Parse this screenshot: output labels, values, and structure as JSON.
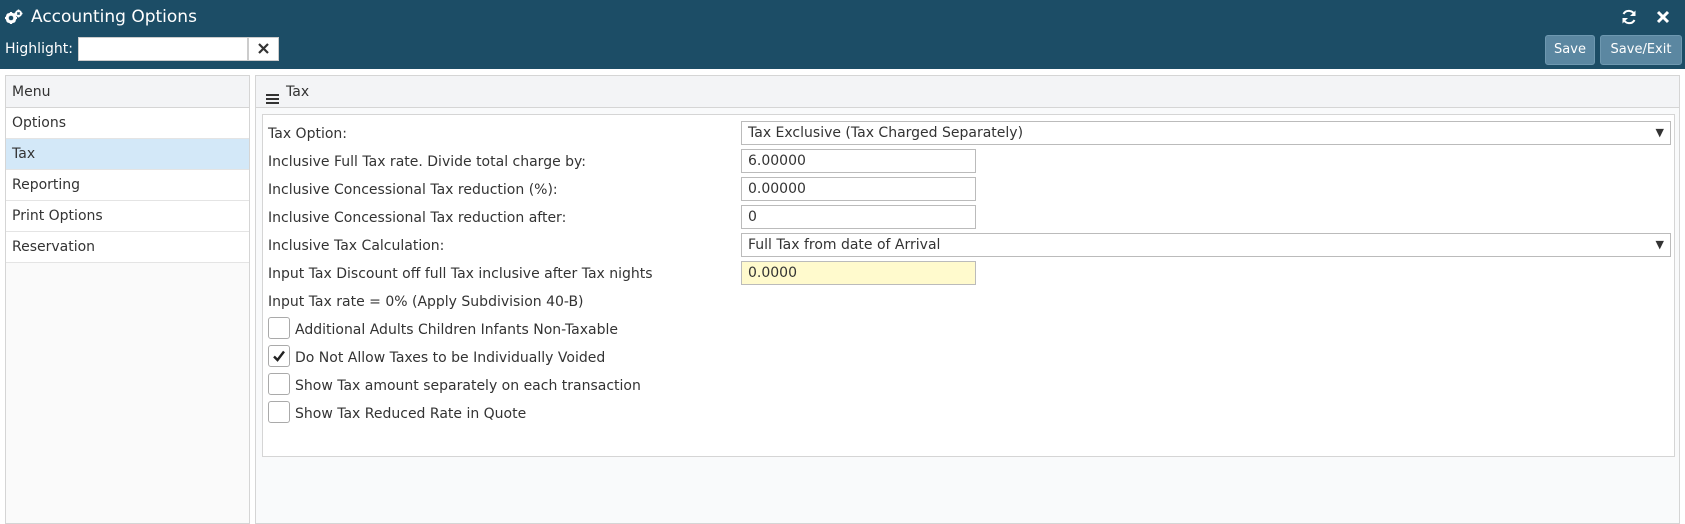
{
  "header": {
    "title": "Accounting Options",
    "app_icon": "cogs-icon",
    "highlight_label": "Highlight:",
    "highlight_value": "",
    "save_label": "Save",
    "save_exit_label": "Save/Exit",
    "accent_color": "#1c4d66"
  },
  "sidebar": {
    "heading": "Menu",
    "items": [
      {
        "label": "Options",
        "active": false
      },
      {
        "label": "Tax",
        "active": true
      },
      {
        "label": "Reporting",
        "active": false
      },
      {
        "label": "Print Options",
        "active": false
      },
      {
        "label": "Reservation",
        "active": false
      }
    ]
  },
  "main": {
    "heading": "Tax",
    "fields": {
      "tax_option": {
        "label": "Tax Option:",
        "value": "Tax Exclusive (Tax Charged Separately)"
      },
      "full_rate": {
        "label": "Inclusive Full Tax rate. Divide total charge by:",
        "value": "6.00000"
      },
      "concessional_reduction": {
        "label": "Inclusive Concessional Tax reduction (%):",
        "value": "0.00000"
      },
      "concessional_after": {
        "label": "Inclusive Concessional Tax reduction after:",
        "value": "0"
      },
      "tax_calculation": {
        "label": "Inclusive Tax Calculation:",
        "value": "Full Tax from date of Arrival"
      },
      "input_discount": {
        "label": "Input Tax Discount off full Tax inclusive after Tax nights",
        "value": "0.0000"
      }
    },
    "input_tax_note": "Input Tax rate = 0% (Apply Subdivision 40-B)",
    "checkboxes": [
      {
        "label": "Additional Adults Children Infants Non-Taxable",
        "checked": false
      },
      {
        "label": "Do Not Allow Taxes to be Individually Voided",
        "checked": true
      },
      {
        "label": "Show Tax amount separately on each transaction",
        "checked": false
      },
      {
        "label": "Show Tax Reduced Rate in Quote",
        "checked": false
      }
    ]
  }
}
